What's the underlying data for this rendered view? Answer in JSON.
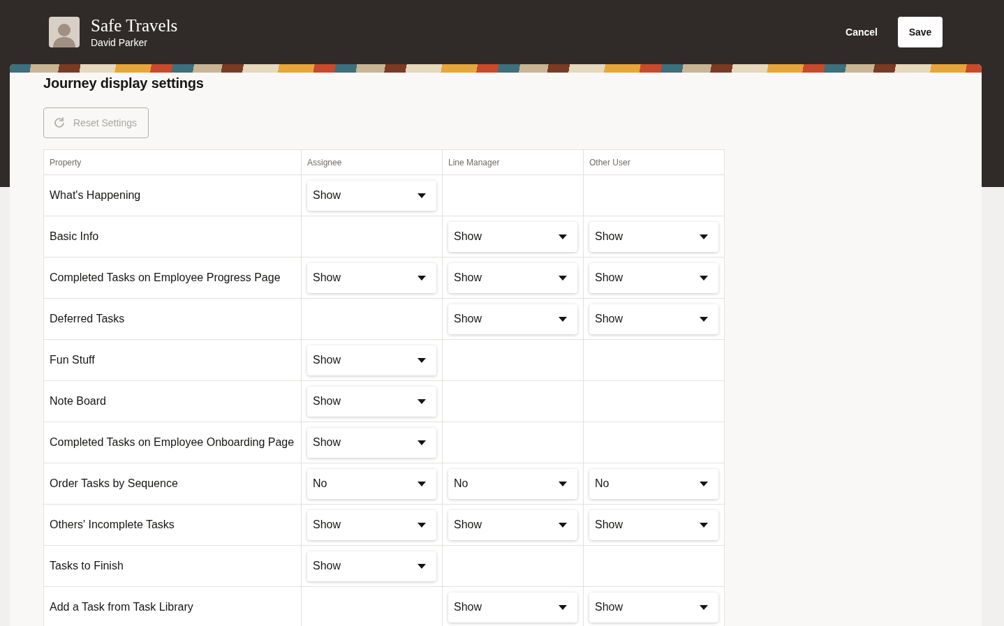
{
  "header": {
    "title": "Safe Travels",
    "subtitle": "David Parker",
    "actions": [
      {
        "label": "Cancel",
        "kind": "text"
      },
      {
        "label": "Save",
        "kind": "solid"
      }
    ]
  },
  "page": {
    "heading": "Journey display settings",
    "reset_button": {
      "label": "Reset Settings",
      "disabled": true
    }
  },
  "table": {
    "columns": [
      "Property",
      "Assignee",
      "Line Manager",
      "Other User"
    ],
    "rows": [
      {
        "property": "What's Happening",
        "assignee": "Show"
      },
      {
        "property": "Basic Info",
        "line_manager": "Show",
        "other_user": "Show"
      },
      {
        "property": "Completed Tasks on Employee Progress Page",
        "assignee": "Show",
        "line_manager": "Show",
        "other_user": "Show"
      },
      {
        "property": "Deferred Tasks",
        "line_manager": "Show",
        "other_user": "Show"
      },
      {
        "property": "Fun Stuff",
        "assignee": "Show"
      },
      {
        "property": "Note Board",
        "assignee": "Show"
      },
      {
        "property": "Completed Tasks on Employee Onboarding Page",
        "assignee": "Show"
      },
      {
        "property": "Order Tasks by Sequence",
        "assignee": "No",
        "line_manager": "No",
        "other_user": "No"
      },
      {
        "property": "Others' Incomplete Tasks",
        "assignee": "Show",
        "line_manager": "Show",
        "other_user": "Show"
      },
      {
        "property": "Tasks to Finish",
        "assignee": "Show"
      },
      {
        "property": "Add a Task from Task Library",
        "line_manager": "Show",
        "other_user": "Show"
      }
    ]
  }
}
